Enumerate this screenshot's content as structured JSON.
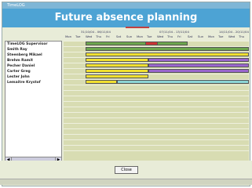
{
  "window": {
    "title": "TimeLOG"
  },
  "header": {
    "title": "Future absence planning"
  },
  "grid": {
    "weeks": [
      "31/10/04 - 06/11/04",
      "07/11/04 - 13/11/04",
      "14/11/04 - 20/11/04"
    ],
    "days": [
      "Mon",
      "Tue",
      "Wed",
      "Thu",
      "Fri",
      "Sat",
      "Sun",
      "Mon",
      "Tue",
      "Wed",
      "Thu",
      "Fri",
      "Sat",
      "Sun",
      "Mon",
      "Tue",
      "Wed",
      "Thu"
    ]
  },
  "employees": [
    "TimeLOG Supervisor",
    "Smith Ray",
    "Steenberg Mikael",
    "Brehm Ramit",
    "Pecher Daniel",
    "Carter Greg",
    "Lester John",
    "Lemaitre Krystof"
  ],
  "colors": {
    "green": "#6ca64d",
    "red": "#cc3333",
    "yellow": "#f0e030",
    "purple": "#9966cc",
    "cyan": "#8cd4d4"
  },
  "buttons": {
    "close": "Close"
  }
}
